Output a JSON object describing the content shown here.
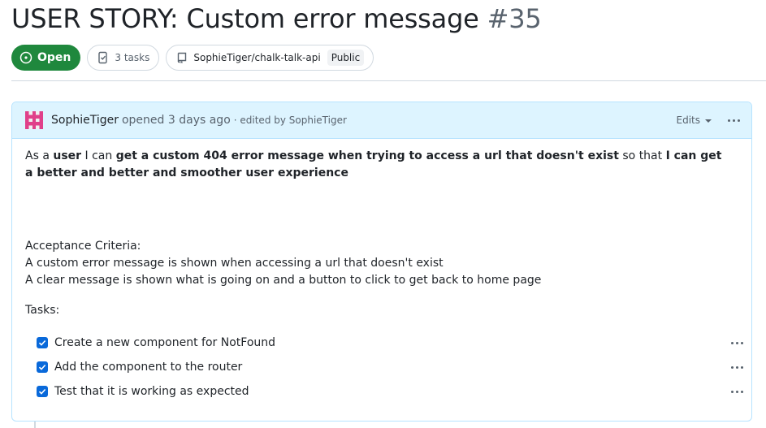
{
  "issue": {
    "title": "USER STORY: Custom error message",
    "number": "#35",
    "state": "Open",
    "tasks_label": "3 tasks",
    "repo": "SophieTiger/chalk-talk-api",
    "visibility": "Public"
  },
  "comment": {
    "author": "SophieTiger",
    "opened_text": "opened 3 days ago",
    "edited_text": "· edited by SophieTiger",
    "edits_label": "Edits",
    "body": {
      "p1_a": "As a ",
      "p1_b": "user",
      "p1_c": " I can ",
      "p1_d": "get a custom 404 error message when trying to access a url that doesn't exist",
      "p1_e": " so that ",
      "p1_f": "I can get a better and better and smoother user experience",
      "criteria_title": "Acceptance Criteria:",
      "criteria_1": "A custom error message is shown when accessing a url that doesn't exist",
      "criteria_2": "A clear message is shown what is going on and a button to click to get back to home page",
      "tasks_title": "Tasks:",
      "tasks": [
        {
          "label": "Create a new component for NotFound",
          "checked": true
        },
        {
          "label": "Add the component to the router",
          "checked": true
        },
        {
          "label": "Test that it is working as expected",
          "checked": true
        }
      ]
    }
  },
  "colors": {
    "open_green": "#1f883d",
    "header_blue": "#ddf4ff",
    "border_blue": "#b6e3ff",
    "checkbox_blue": "#0969da",
    "avatar_pink": "#e0408a"
  },
  "icons": [
    "issue-opened-icon",
    "tasklist-icon",
    "repo-icon",
    "kebab-horizontal-icon",
    "triangle-down-icon",
    "check-icon",
    "smiley-icon"
  ]
}
